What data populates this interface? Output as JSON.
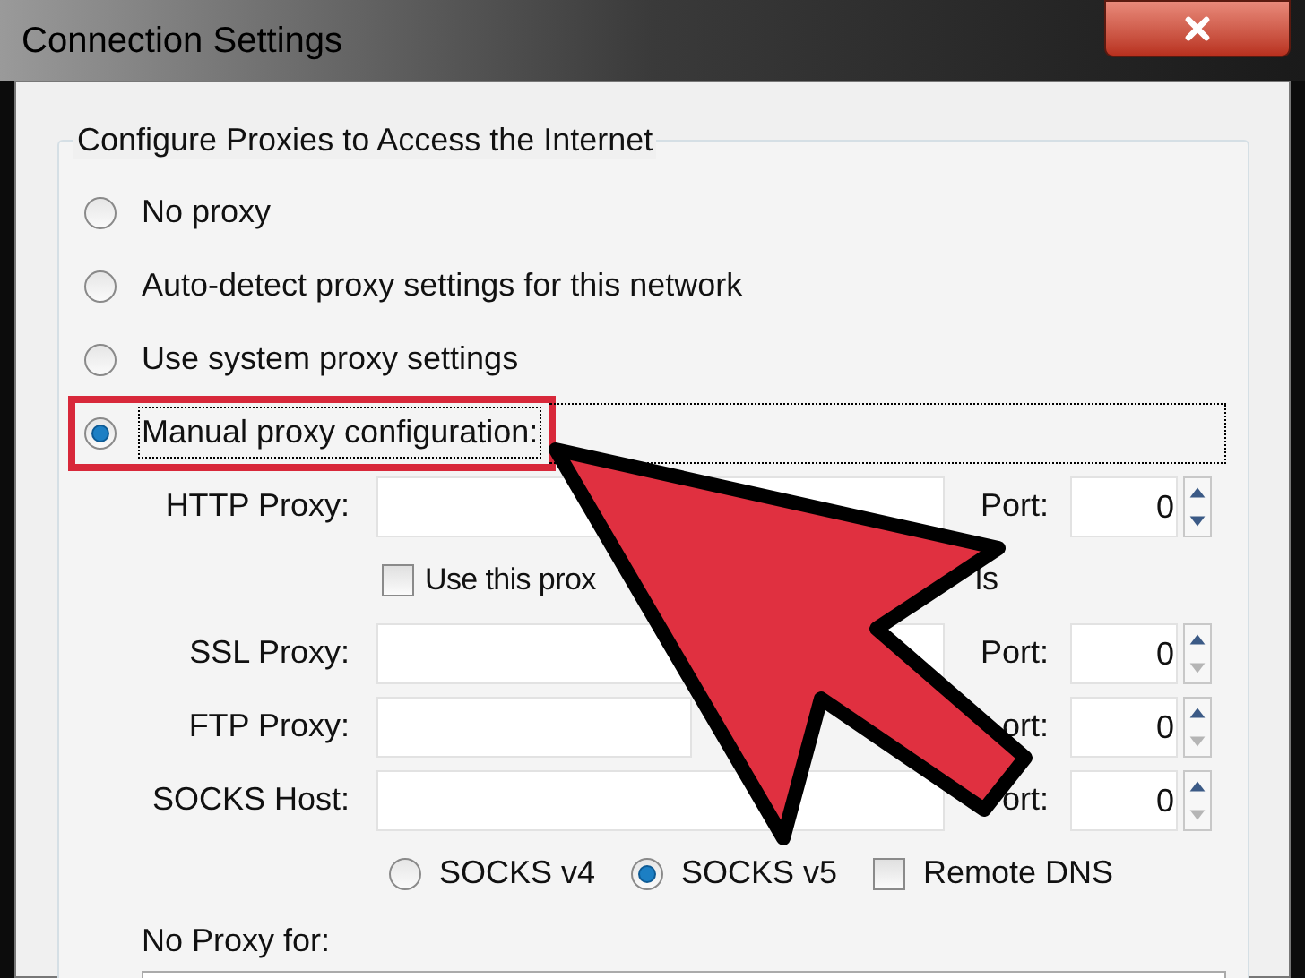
{
  "window": {
    "title": "Connection Settings"
  },
  "group": {
    "title": "Configure Proxies to Access the Internet"
  },
  "proxy_modes": [
    {
      "label": "No proxy",
      "selected": false,
      "highlighted": false
    },
    {
      "label": "Auto-detect proxy settings for this network",
      "selected": false,
      "highlighted": false
    },
    {
      "label": "Use system proxy settings",
      "selected": false,
      "highlighted": false
    },
    {
      "label": "Manual proxy configuration:",
      "selected": true,
      "highlighted": true
    }
  ],
  "proxies": [
    {
      "kind": "proxy",
      "label": "HTTP Proxy:",
      "port_label": "Port:",
      "port": "0",
      "down_disabled": false
    },
    {
      "kind": "checkbox",
      "label": "Use this prox",
      "label_end": "ls",
      "checked": false
    },
    {
      "kind": "proxy",
      "label": "SSL Proxy:",
      "port_label": "Port:",
      "port": "0",
      "down_disabled": true
    },
    {
      "kind": "proxy",
      "label": "FTP Proxy:",
      "port_label": "ort:",
      "port": "0",
      "down_disabled": true
    },
    {
      "kind": "proxy",
      "label": "SOCKS Host:",
      "port_label": "ort:",
      "port": "0",
      "down_disabled": true
    }
  ],
  "socks_versions": [
    {
      "label": "SOCKS v4",
      "selected": false
    },
    {
      "label": "SOCKS v5",
      "selected": true
    }
  ],
  "remote_dns": {
    "label": "Remote DNS",
    "checked": false
  },
  "no_proxy": {
    "label": "No Proxy for:"
  }
}
